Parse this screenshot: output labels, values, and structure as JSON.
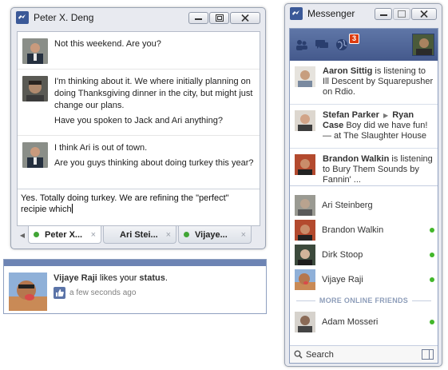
{
  "chat_window": {
    "title": "Peter X. Deng",
    "messages": [
      {
        "lines": [
          "Not this weekend. Are you?"
        ]
      },
      {
        "lines": [
          "I'm thinking about it. We where initially planning on doing Thanksgiving dinner in the city, but might just change our plans.",
          "Have you spoken to Jack and Ari anything?"
        ]
      },
      {
        "lines": [
          "I think Ari is out of town.",
          "Are you guys thinking about doing turkey this year?"
        ]
      }
    ],
    "composer_value": "Yes. Totally doing turkey. We are refining the \"perfect\" recipie which",
    "tabs": [
      {
        "label": "Peter X...",
        "close": "×",
        "active": true,
        "online": true
      },
      {
        "label": "Ari Stei...",
        "close": "×",
        "active": false,
        "online": false
      },
      {
        "label": "Vijaye...",
        "close": "×",
        "active": false,
        "online": true
      }
    ]
  },
  "notification": {
    "actor": "Vijaye Raji",
    "text": " likes your ",
    "object": "status",
    "end": ".",
    "time": "a few seconds ago"
  },
  "messenger": {
    "title": "Messenger",
    "badge_count": "3",
    "ticker": [
      {
        "name": "Aaron Sittig",
        "rest": " is listening to Ill Descent by Squarepusher on Rdio."
      },
      {
        "name": "Stefan Parker",
        "arrow": "▶",
        "name2": "Ryan Case",
        "rest": " Boy did we have fun! — at The Slaughter House"
      },
      {
        "name": "Brandon Walkin",
        "rest": " is listening to Bury Them Sounds by Fannin' ..."
      }
    ],
    "friends": [
      {
        "name": "Ari Steinberg",
        "online": false
      },
      {
        "name": "Brandon Walkin",
        "online": true
      },
      {
        "name": "Dirk Stoop",
        "online": true
      },
      {
        "name": "Vijaye Raji",
        "online": true
      }
    ],
    "more_label": "MORE ONLINE FRIENDS",
    "more_friends": [
      {
        "name": "Adam Mosseri",
        "online": true
      }
    ],
    "search_label": "Search"
  },
  "colors": {
    "facebook_blue": "#3b5998",
    "online_green": "#42b72a",
    "badge_red": "#dd3c10"
  }
}
